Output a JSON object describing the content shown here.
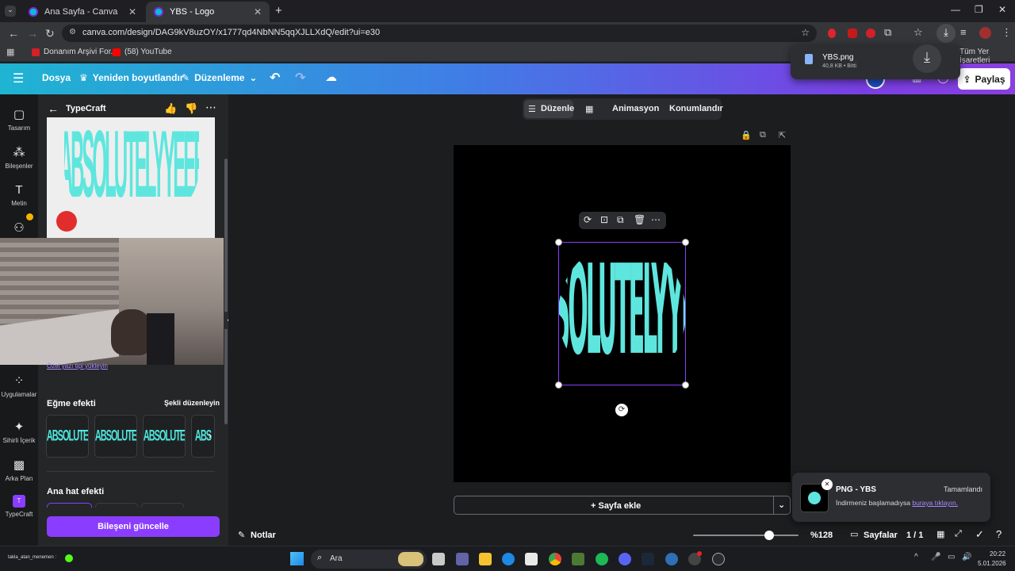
{
  "browser": {
    "tabs": [
      {
        "label": "Ana Sayfa - Canva",
        "active": false
      },
      {
        "label": "YBS - Logo",
        "active": true
      }
    ],
    "url": "canva.com/design/DAG9kV8uzOY/x1777qd4NbNN5qqXJLLXdQ/edit?ui=e30",
    "bookmarks": [
      {
        "label": "Donanım Arşivi For..."
      },
      {
        "label": "(58) YouTube"
      }
    ],
    "all_bookmarks_label": "Tüm Yer İşaretleri"
  },
  "download_popup": {
    "filename": "YBS.png",
    "meta": "40,8 KB • Bitti"
  },
  "header": {
    "file_label": "Dosya",
    "resize_label": "Yeniden boyutlandır",
    "edit_label": "Düzenleme",
    "doc_name": "YBS",
    "share_label": "Paylaş"
  },
  "rail": [
    {
      "label": "Tasarım",
      "icon": "design-icon"
    },
    {
      "label": "Bileşenler",
      "icon": "elements-icon"
    },
    {
      "label": "Metin",
      "icon": "text-icon"
    },
    {
      "label": "",
      "icon": "brand-icon"
    },
    {
      "label": "Uygulamalar",
      "icon": "apps-icon"
    },
    {
      "label": "Sihirli İçerik",
      "icon": "magic-icon"
    },
    {
      "label": "Arka Plan",
      "icon": "background-icon"
    },
    {
      "label": "TypeCraft",
      "icon": "typecraft-icon"
    }
  ],
  "panel": {
    "title": "TypeCraft",
    "thumb_text": "ABSOLUTELYYEEE",
    "custom_font_link": "Özel yazı tipi yükleyin",
    "warp_title": "Eğme efekti",
    "warp_action": "Şekli düzenleyin",
    "warp_cards": [
      "ABSOLUTE",
      "ABSOLUTE",
      "ABSOLUTE",
      "ABS"
    ],
    "outline_title": "Ana hat efekti",
    "update_button": "Bileşeni güncelle"
  },
  "canvas_toolbar": {
    "edit_label": "Düzenle",
    "animate_label": "Animasyon",
    "position_label": "Konumlandır"
  },
  "design": {
    "logo_text": "ABSOLUTELYYEEE",
    "text_color": "#5ee6de",
    "background_color": "#000000"
  },
  "add_page_label": "+ Sayfa ekle",
  "bottom": {
    "notes_label": "Notlar",
    "zoom_label": "%128",
    "zoom_level": 0.72,
    "pages_label": "Sayfalar",
    "page_count": "1 / 1"
  },
  "toast": {
    "title": "PNG - YBS",
    "status": "Tamamlandı",
    "message": "İndirmeniz başlamadıysa ",
    "link": "buraya tıklayın."
  },
  "taskbar": {
    "search_label": "Ara",
    "clock_time": "20:22",
    "clock_date": "5.01.2026",
    "overlay_user": "takla_atan_menemen :"
  }
}
